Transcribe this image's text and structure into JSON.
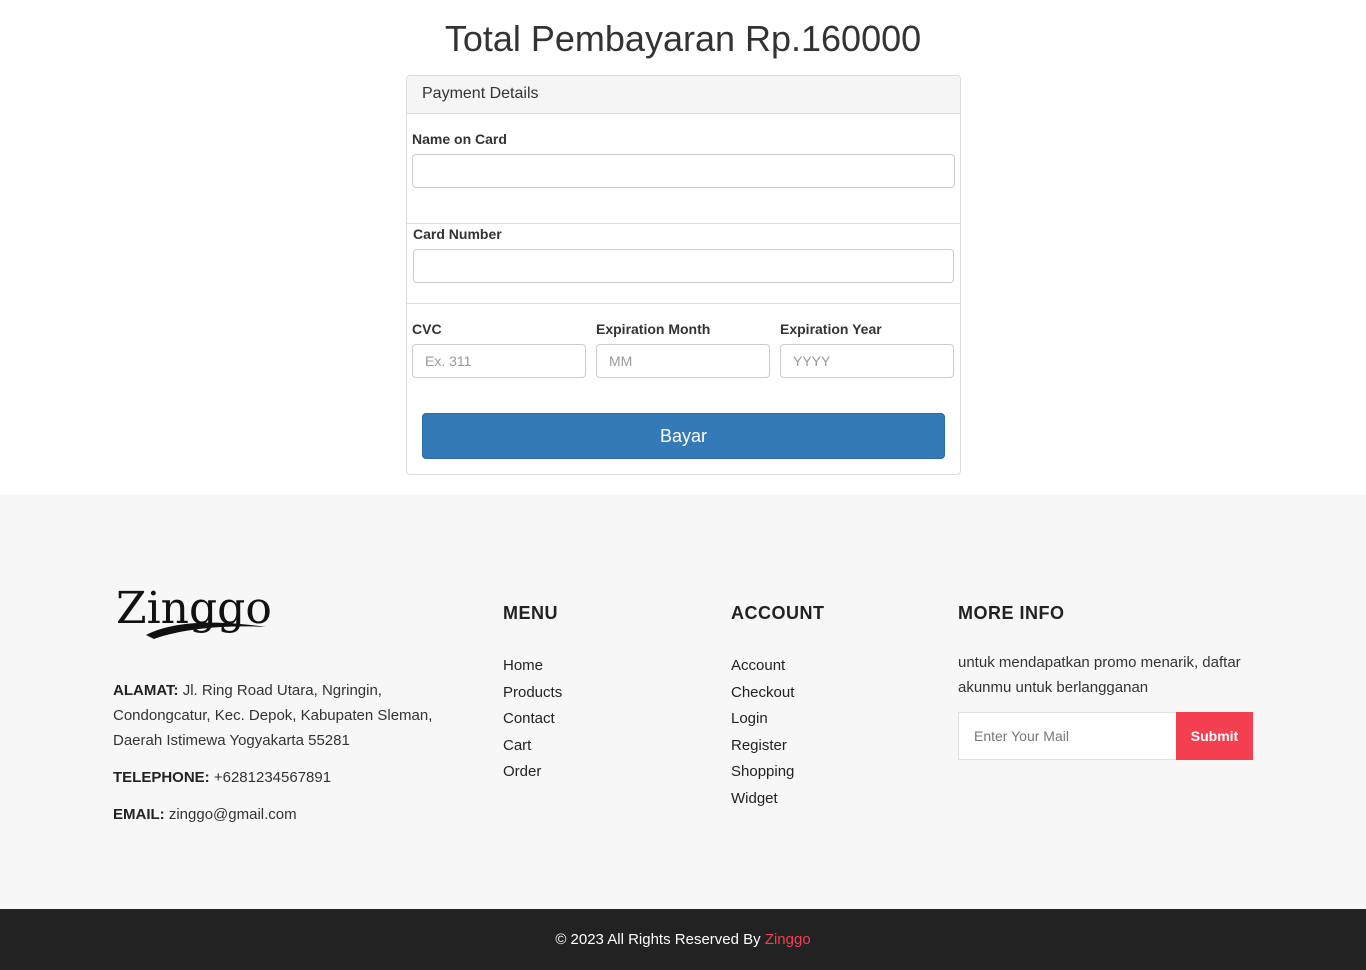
{
  "page": {
    "title": "Total Pembayaran Rp.160000"
  },
  "payment": {
    "heading": "Payment Details",
    "name_label": "Name on Card",
    "name_value": "",
    "card_label": "Card Number",
    "card_value": "",
    "cvc_label": "CVC",
    "cvc_placeholder": "Ex. 311",
    "month_label": "Expiration Month",
    "month_placeholder": "MM",
    "year_label": "Expiration Year",
    "year_placeholder": "YYYY",
    "pay_button": "Bayar"
  },
  "footer": {
    "logo_text": "Zinggo",
    "address_label": "ALAMAT:",
    "address_value": "Jl. Ring Road Utara, Ngringin, Condongcatur, Kec. Depok, Kabupaten Sleman, Daerah Istimewa Yogyakarta 55281",
    "telephone_label": "TELEPHONE:",
    "telephone_value": "+6281234567891",
    "email_label": "EMAIL:",
    "email_value": "zinggo@gmail.com",
    "menu_title": "MENU",
    "menu_items": [
      "Home",
      "Products",
      "Contact",
      "Cart",
      "Order"
    ],
    "account_title": "ACCOUNT",
    "account_items": [
      "Account",
      "Checkout",
      "Login",
      "Register",
      "Shopping",
      "Widget"
    ],
    "info_title": "MORE INFO",
    "info_text": "untuk mendapatkan promo menarik, daftar akunmu untuk berlangganan",
    "mail_placeholder": "Enter Your Mail",
    "submit_label": "Submit"
  },
  "copyright": {
    "text": "© 2023 All Rights Reserved By",
    "brand": "Zinggo"
  },
  "colors": {
    "primary": "#337ab7",
    "accent": "#f33f4f",
    "footer_bg": "#f7f7f7",
    "bottom_bar": "#222222"
  }
}
